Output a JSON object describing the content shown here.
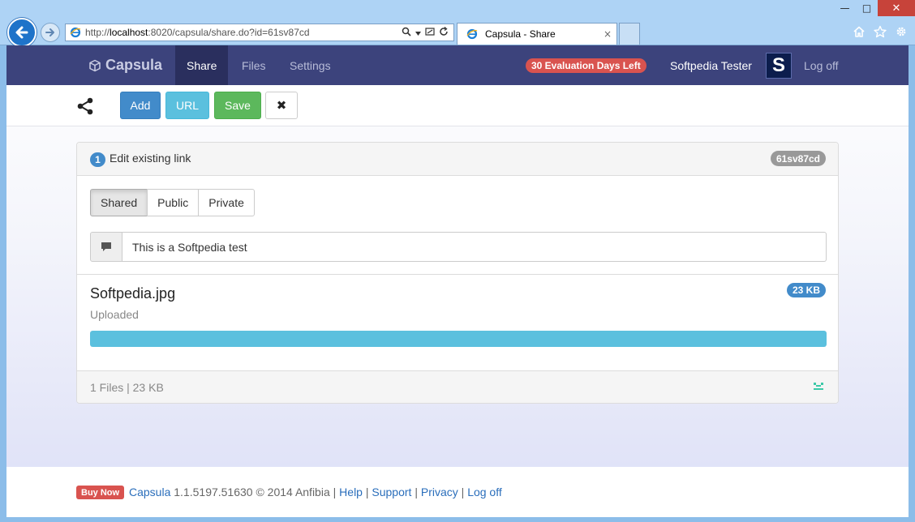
{
  "browser": {
    "address_prefix": "http://",
    "address_host": "localhost",
    "address_rest": ":8020/capsula/share.do?id=61sv87cd",
    "tab_title": "Capsula - Share",
    "tab_close": "×",
    "win_minimize": "—",
    "win_maximize": "□",
    "win_close": "✕"
  },
  "navbar": {
    "brand": "Capsula",
    "items": [
      {
        "label": "Share",
        "active": true
      },
      {
        "label": "Files",
        "active": false
      },
      {
        "label": "Settings",
        "active": false
      }
    ],
    "trial_badge": "30 Evaluation Days Left",
    "user_name": "Softpedia Tester",
    "avatar_letter": "S",
    "logoff": "Log off"
  },
  "toolbar": {
    "add_label": "Add",
    "url_label": "URL",
    "save_label": "Save",
    "close_label": "✖"
  },
  "panel": {
    "step": "1",
    "title": "Edit existing link",
    "link_id": "61sv87cd",
    "visibility_options": [
      "Shared",
      "Public",
      "Private"
    ],
    "visibility_selected": "Shared",
    "comment_value": "This is a Softpedia test",
    "file": {
      "name": "Softpedia.jpg",
      "size": "23 KB",
      "status": "Uploaded",
      "progress_percent": 100
    },
    "summary": "1 Files | 23 KB"
  },
  "footer": {
    "buy_label": "Buy Now",
    "product_link": "Capsula",
    "version_text": " 1.1.5197.51630 © 2014 Anfibia ",
    "links": [
      "Help",
      "Support",
      "Privacy",
      "Log off"
    ]
  },
  "colors": {
    "navbar": "#3c437c",
    "primary": "#428bca",
    "info": "#5bc0de",
    "success": "#5cb85c",
    "danger": "#d9534f"
  }
}
